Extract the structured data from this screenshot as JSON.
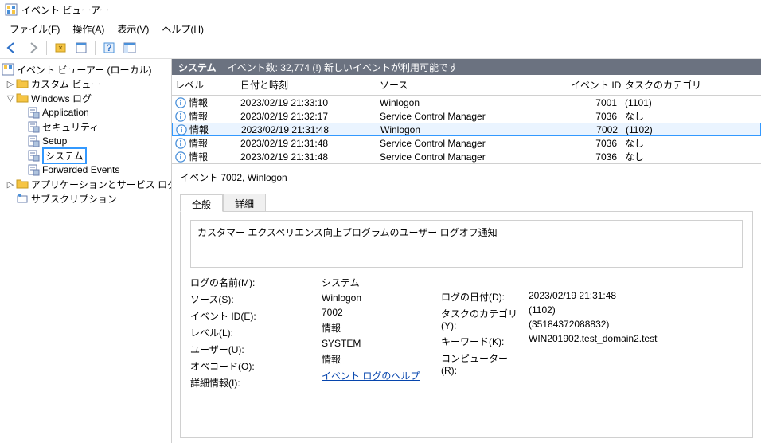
{
  "window": {
    "title": "イベント ビューアー"
  },
  "menu": {
    "file": "ファイル(F)",
    "action": "操作(A)",
    "view": "表示(V)",
    "help": "ヘルプ(H)"
  },
  "tree": {
    "root": "イベント ビューアー (ローカル)",
    "custom_views": "カスタム ビュー",
    "windows_logs": "Windows ログ",
    "app": "Application",
    "sec": "セキュリティ",
    "setup": "Setup",
    "system": "システム",
    "forwarded": "Forwarded Events",
    "app_svc": "アプリケーションとサービス ログ",
    "sub": "サブスクリプション"
  },
  "header": {
    "title": "システム",
    "summary": "イベント数: 32,774 (!) 新しいイベントが利用可能です"
  },
  "columns": {
    "level": "レベル",
    "datetime": "日付と時刻",
    "source": "ソース",
    "event_id": "イベント ID",
    "category": "タスクのカテゴリ"
  },
  "rows": [
    {
      "level": "情報",
      "dt": "2023/02/19 21:33:10",
      "src": "Winlogon",
      "id": "7001",
      "cat": "(1101)"
    },
    {
      "level": "情報",
      "dt": "2023/02/19 21:32:17",
      "src": "Service Control Manager",
      "id": "7036",
      "cat": "なし"
    },
    {
      "level": "情報",
      "dt": "2023/02/19 21:31:48",
      "src": "Winlogon",
      "id": "7002",
      "cat": "(1102)"
    },
    {
      "level": "情報",
      "dt": "2023/02/19 21:31:48",
      "src": "Service Control Manager",
      "id": "7036",
      "cat": "なし"
    },
    {
      "level": "情報",
      "dt": "2023/02/19 21:31:48",
      "src": "Service Control Manager",
      "id": "7036",
      "cat": "なし"
    }
  ],
  "selected_row": 2,
  "detail": {
    "title": "イベント 7002, Winlogon",
    "tabs": {
      "general": "全般",
      "details": "詳細"
    },
    "message": "カスタマー エクスペリエンス向上プログラムのユーザー ログオフ通知",
    "fields": {
      "log_name_label": "ログの名前(M):",
      "log_name": "システム",
      "source_label": "ソース(S):",
      "source": "Winlogon",
      "event_id_label": "イベント ID(E):",
      "event_id": "7002",
      "level_label": "レベル(L):",
      "level": "情報",
      "user_label": "ユーザー(U):",
      "user": "SYSTEM",
      "opcode_label": "オペコード(O):",
      "opcode": "情報",
      "more_label": "詳細情報(I):",
      "more_link": "イベント ログのヘルプ",
      "log_date_label": "ログの日付(D):",
      "log_date": "2023/02/19 21:31:48",
      "task_cat_label": "タスクのカテゴリ(Y):",
      "task_cat": "(1102)",
      "keywords_label": "キーワード(K):",
      "keywords": "(35184372088832)",
      "computer_label": "コンピューター(R):",
      "computer": "WIN201902.test_domain2.test"
    }
  }
}
